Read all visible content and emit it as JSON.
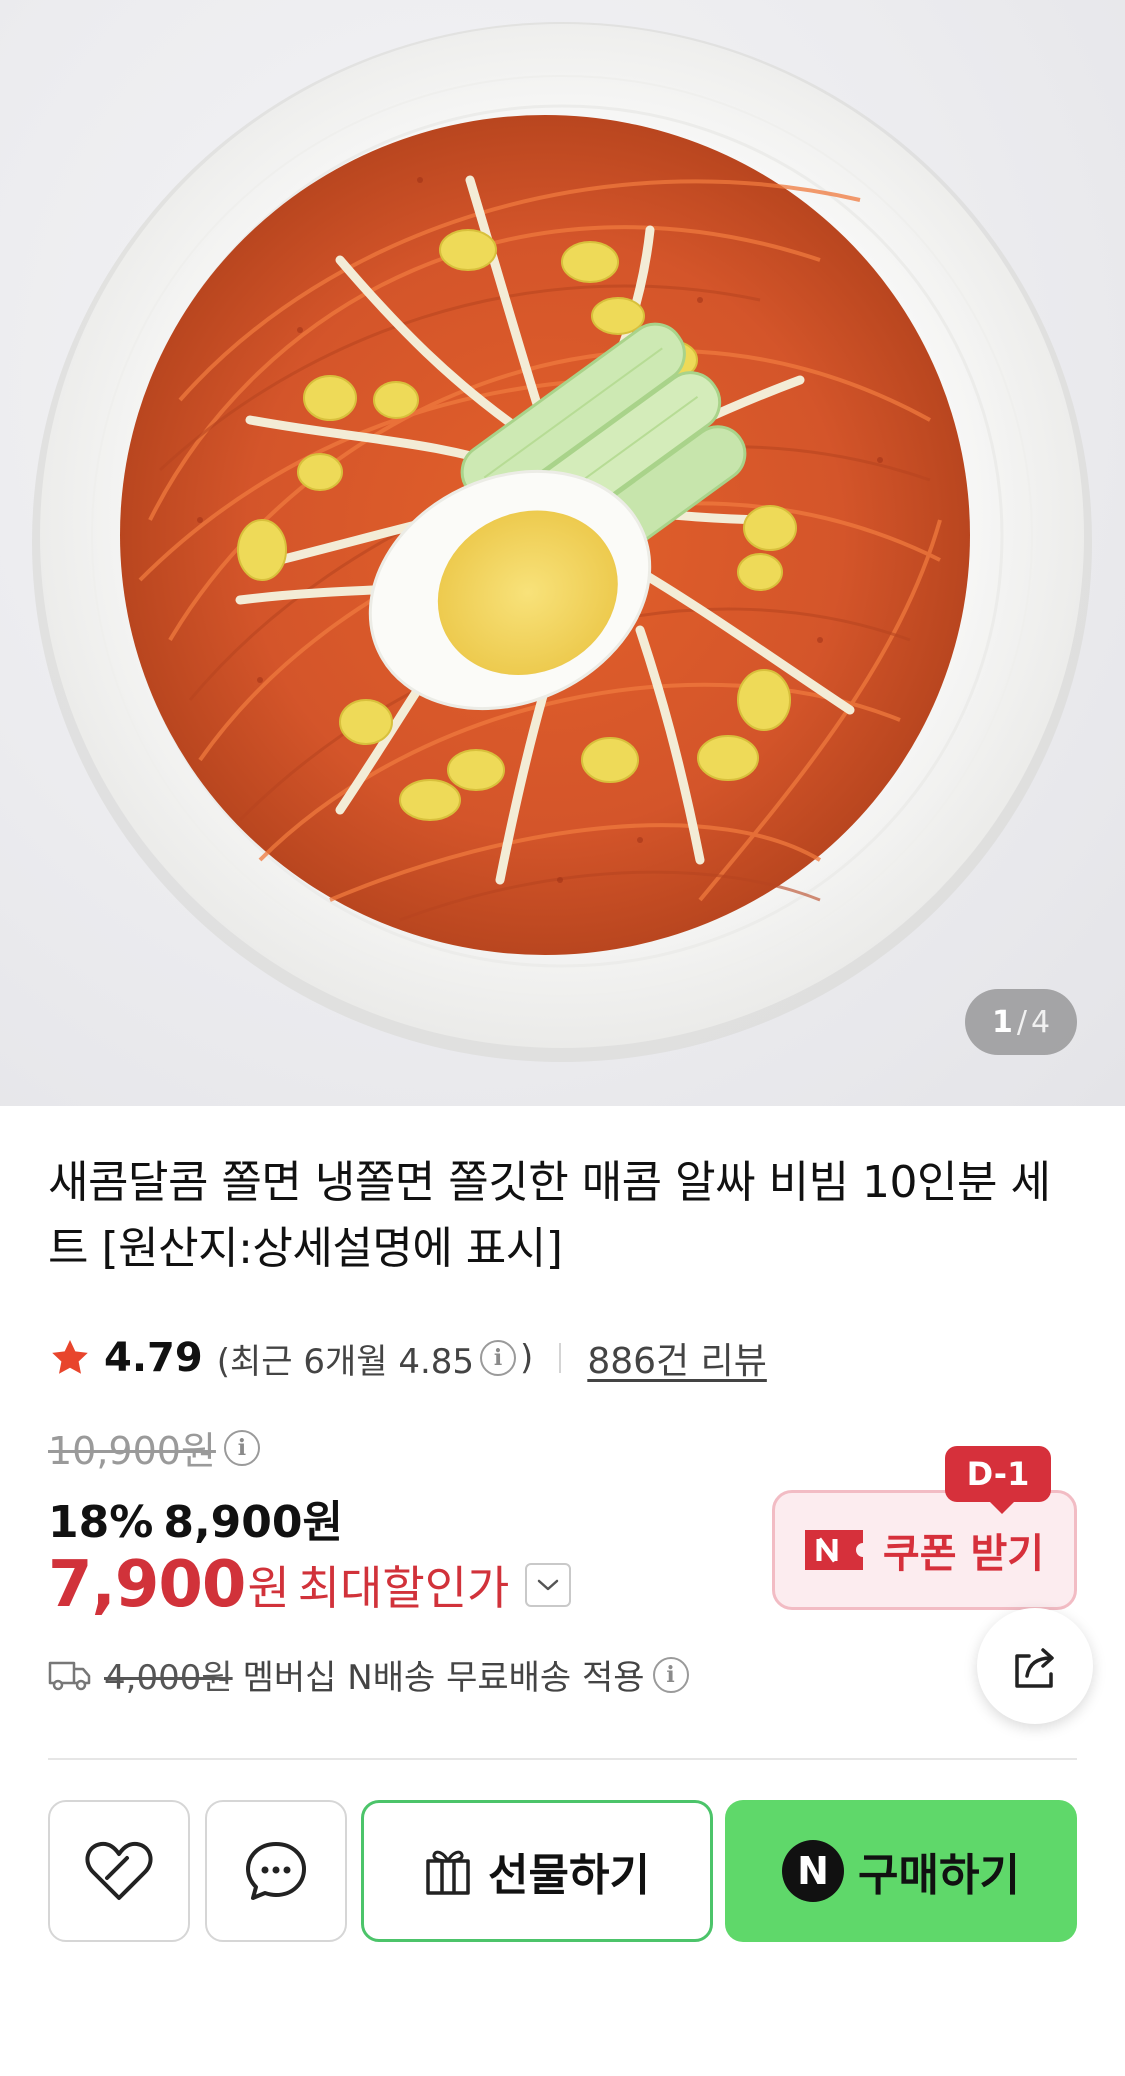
{
  "gallery": {
    "current": "1",
    "separator": "/",
    "total": "4",
    "image_alt": "bibim noodle product photo"
  },
  "product": {
    "title": "새콤달콤 쫄면 냉쫄면 쫄깃한 매콤 알싸 비빔 10인분 세트 [원산지:상세설명에 표시]"
  },
  "rating": {
    "score": "4.79",
    "recent_open": "(최근 6개월 4.85",
    "recent_close": ")",
    "review_link": "886건 리뷰"
  },
  "price": {
    "original": "10,900원",
    "discount_rate": "18%",
    "sale_price": "8,900원",
    "max_price": "7,900",
    "max_unit": "원",
    "max_label": "최대할인가"
  },
  "shipping": {
    "fee": "4,000원",
    "text": "멤버십 N배송 무료배송 적용"
  },
  "coupon": {
    "badge": "D-1",
    "label": "쿠폰 받기",
    "n_mark": "N"
  },
  "actions": {
    "gift_label": "선물하기",
    "buy_label": "구매하기",
    "buy_n_mark": "N"
  },
  "colors": {
    "accent_red": "#d1323a",
    "buy_green": "#5fd86a",
    "gift_border": "#4cc46a",
    "star": "#e8452c"
  },
  "icons": [
    "star-icon",
    "info-icon",
    "chevron-down-icon",
    "truck-icon",
    "share-icon",
    "heart-icon",
    "chat-icon",
    "gift-icon",
    "naver-n-icon"
  ]
}
